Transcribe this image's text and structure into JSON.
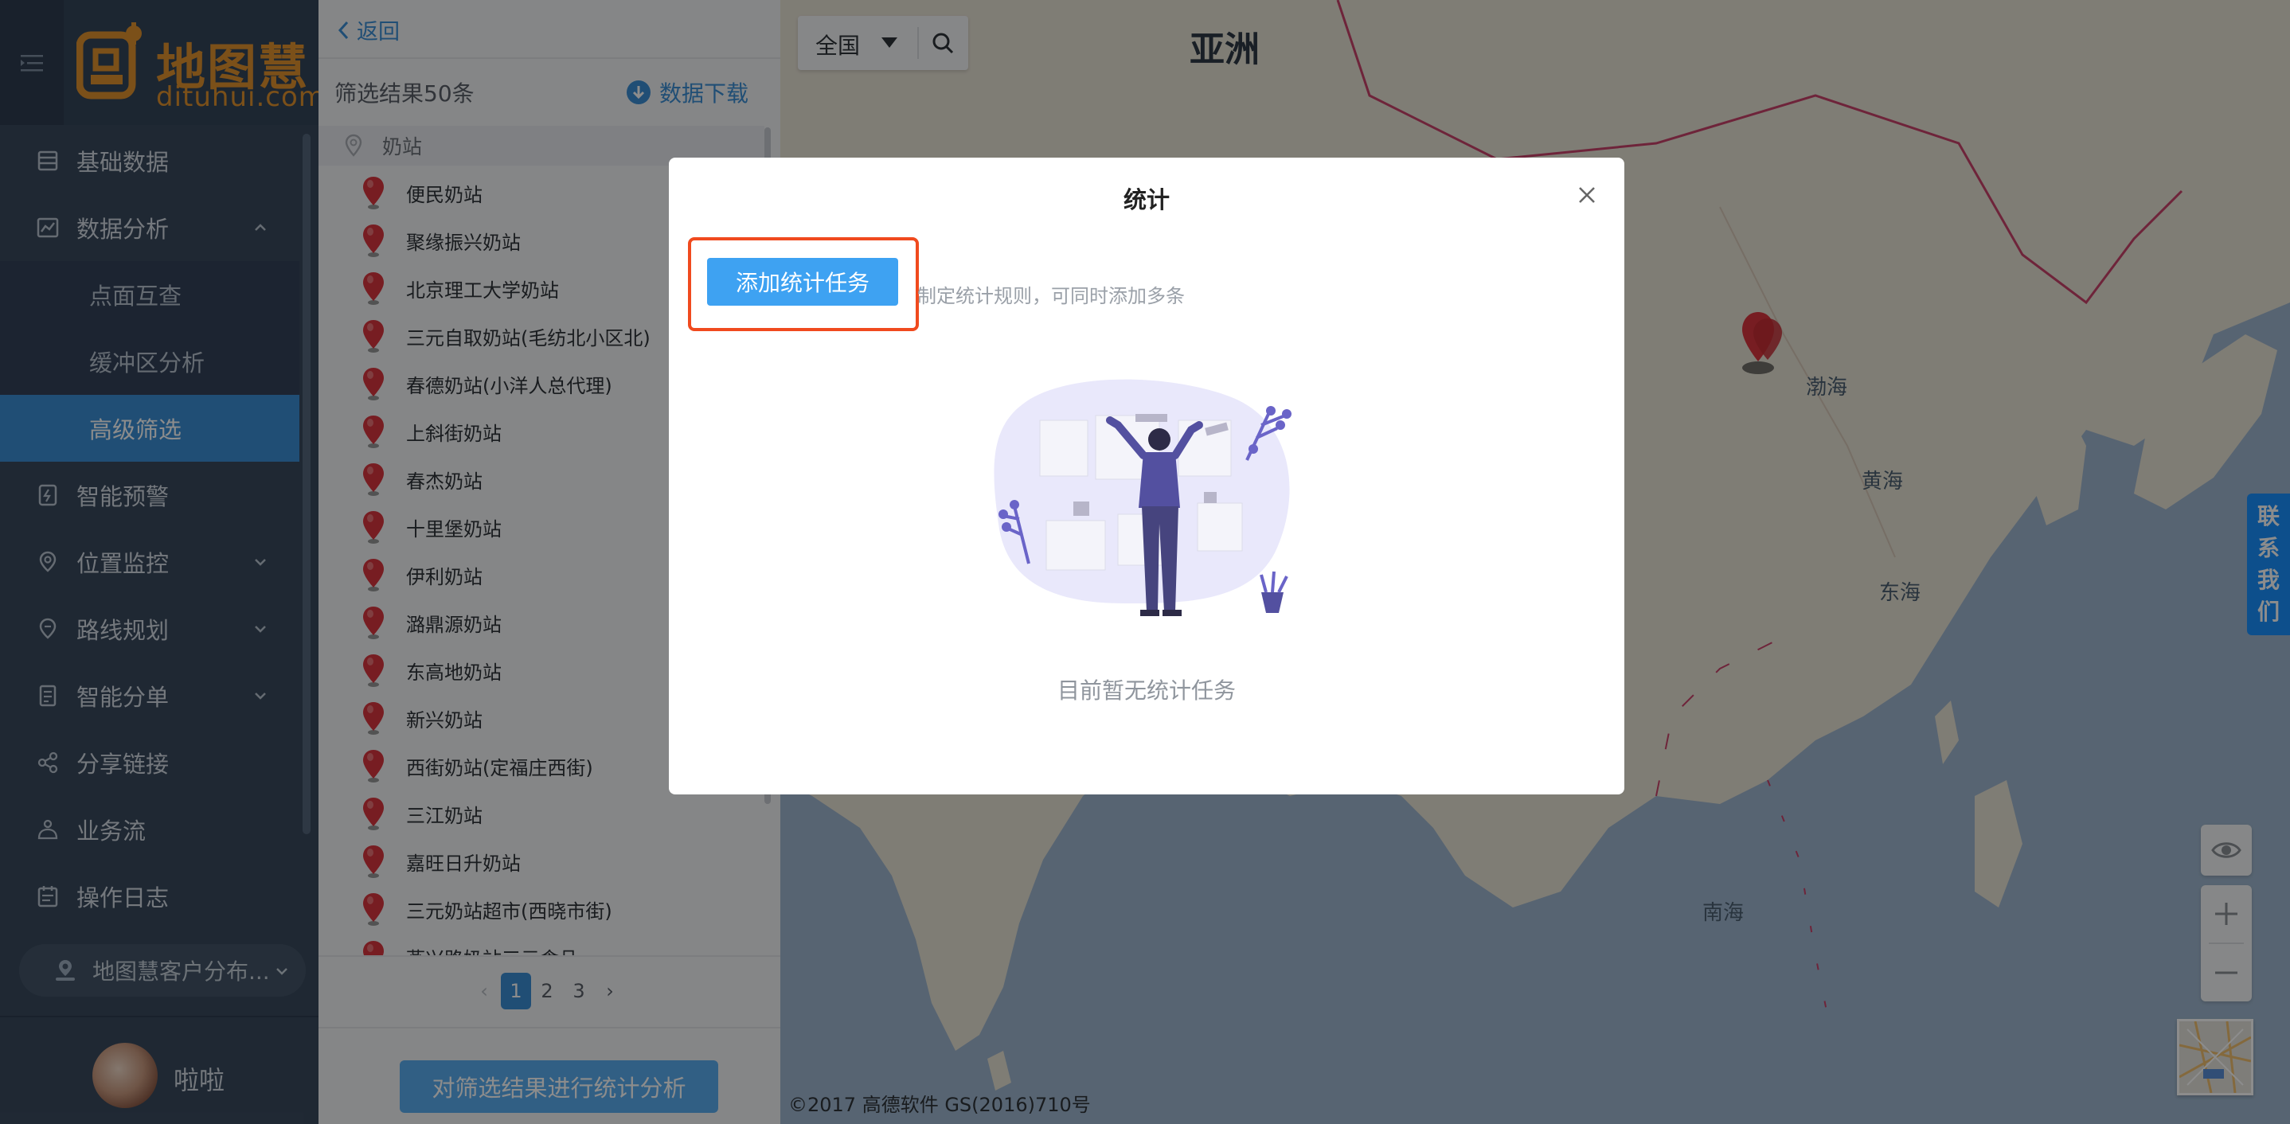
{
  "brand": {
    "name": "地图慧",
    "domain": "dituhui.com",
    "color": "#e0922e"
  },
  "sidebar": {
    "items": [
      {
        "label": "基础数据",
        "icon": "database-icon"
      },
      {
        "label": "数据分析",
        "icon": "analytics-icon",
        "expanded": true,
        "children": [
          {
            "label": "点面互查"
          },
          {
            "label": "缓冲区分析"
          },
          {
            "label": "高级筛选",
            "active": true
          }
        ]
      },
      {
        "label": "智能预警",
        "icon": "alert-icon"
      },
      {
        "label": "位置监控",
        "icon": "location-icon"
      },
      {
        "label": "路线规划",
        "icon": "route-icon"
      },
      {
        "label": "智能分单",
        "icon": "dispatch-icon"
      },
      {
        "label": "分享链接",
        "icon": "share-icon"
      },
      {
        "label": "业务流",
        "icon": "workflow-icon"
      },
      {
        "label": "操作日志",
        "icon": "log-icon"
      }
    ],
    "layer_select": "地图慧客户分布...",
    "user": {
      "name": "啦啦"
    }
  },
  "panel": {
    "back_label": "返回",
    "result_count": "筛选结果50条",
    "download_label": "数据下载",
    "category": "奶站",
    "items": [
      "便民奶站",
      "聚缘振兴奶站",
      "北京理工大学奶站",
      "三元自取奶站(毛纺北小区北)",
      "春德奶站(小洋人总代理)",
      "上斜街奶站",
      "春杰奶站",
      "十里堡奶站",
      "伊利奶站",
      "潞鼎源奶站",
      "东高地奶站",
      "新兴奶站",
      "西街奶站(定福庄西街)",
      "三江奶站",
      "嘉旺日升奶站",
      "三元奶站超市(西晓市街)",
      "燕兴路奶站三元食品"
    ],
    "pagination": {
      "pages": [
        "1",
        "2",
        "3"
      ],
      "current": "1",
      "prev": "‹",
      "next": "›"
    },
    "analyze_label": "对筛选结果进行统计分析"
  },
  "map": {
    "region_label": "全国",
    "labels": {
      "asia": "亚洲",
      "bohai": "渤海",
      "yellow_sea": "黄海",
      "east_sea": "东海",
      "south_sea": "南海"
    },
    "copyright": "©2017 高德软件 GS(2016)710号",
    "contact_chars": [
      "联",
      "系",
      "我",
      "们"
    ]
  },
  "modal": {
    "title": "统计",
    "add_button": "添加统计任务",
    "hint": "制定统计规则，可同时添加多条",
    "empty_text": "目前暂无统计任务"
  },
  "colors": {
    "primary": "#3b8fd5",
    "highlight": "#f04a1e",
    "sidebar_bg": "#3a4a5e"
  }
}
